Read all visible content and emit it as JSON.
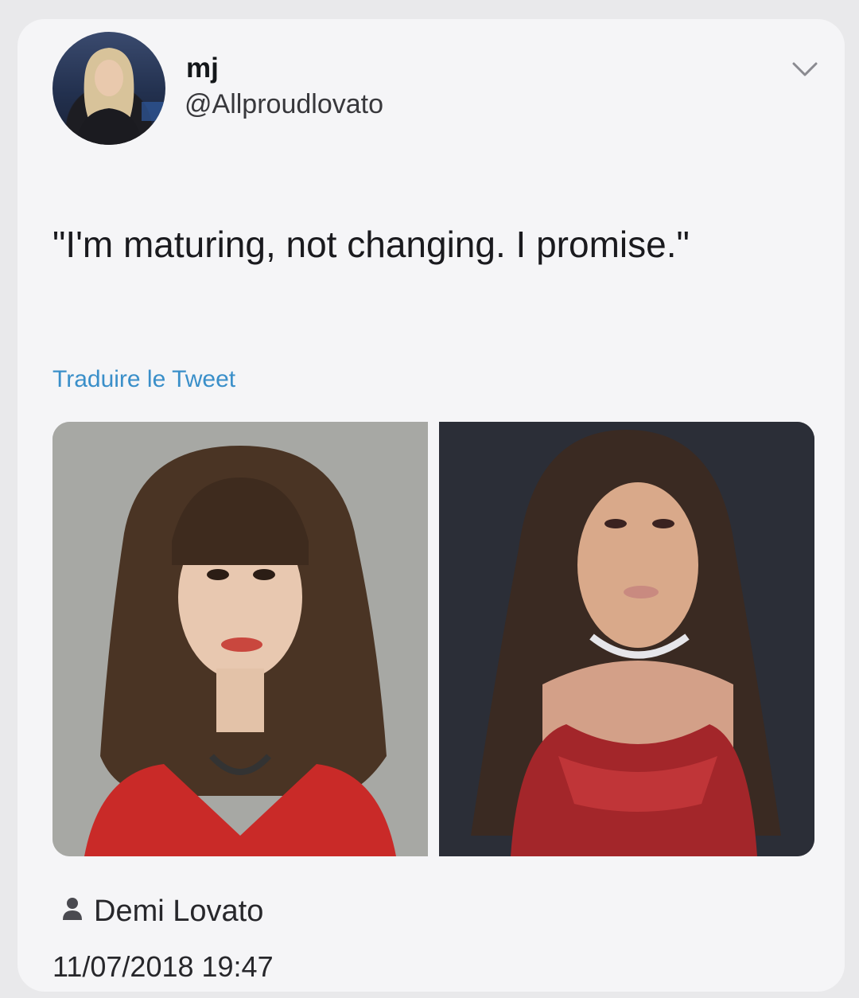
{
  "tweet": {
    "display_name": "mj",
    "handle": "@Allproudlovato",
    "text": "\"I'm maturing, not changing. I promise.\"",
    "translate_label": "Traduire le Tweet",
    "tagged_person": "Demi Lovato",
    "timestamp": "11/07/2018 19:47"
  },
  "icons": {
    "menu": "chevron-down-icon",
    "tag": "person-icon"
  },
  "colors": {
    "link": "#3a8fc9",
    "text": "#1a1a1e",
    "card": "#f5f5f7"
  }
}
